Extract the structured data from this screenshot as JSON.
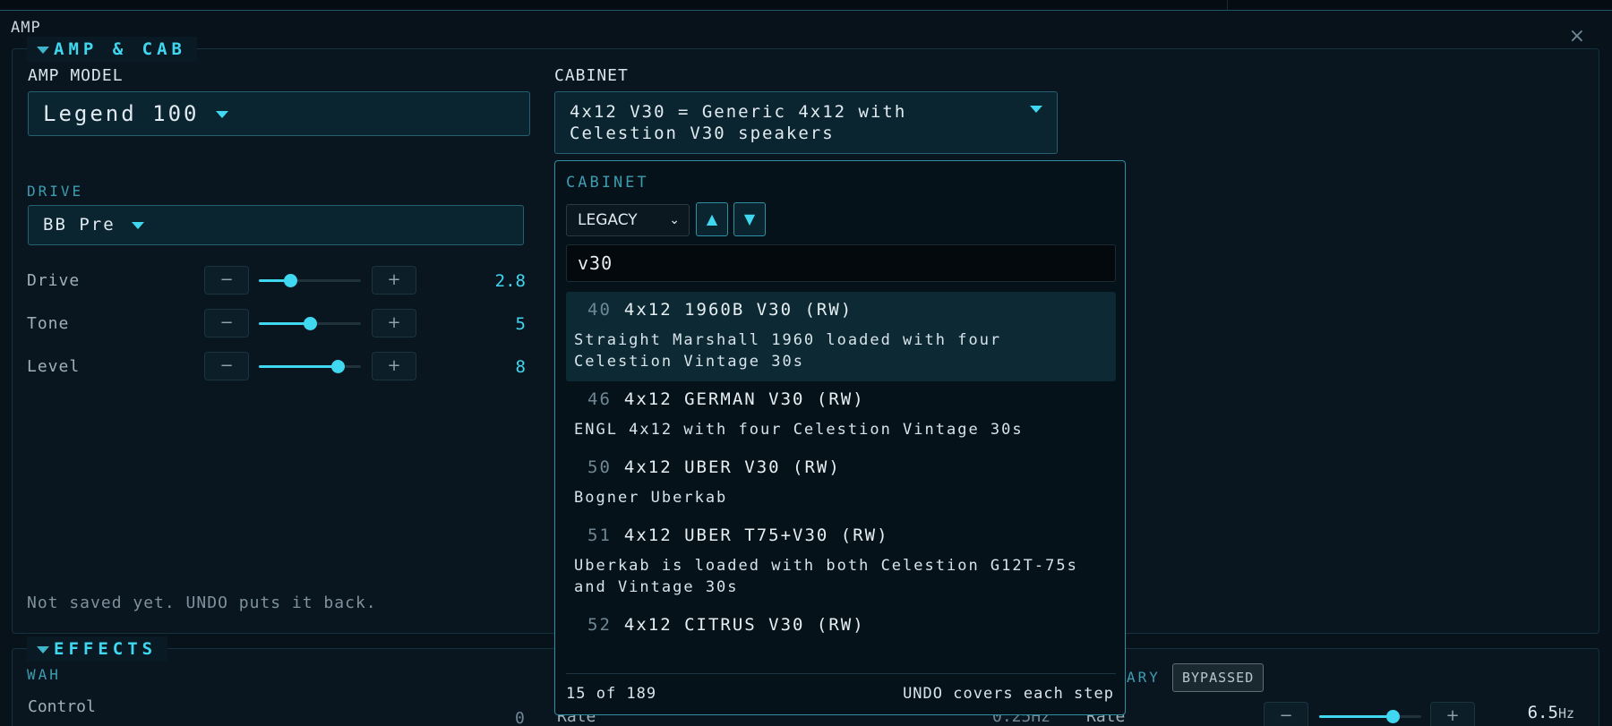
{
  "window": {
    "title": "AMP",
    "close_glyph": "×"
  },
  "amp_section": {
    "tab_label": "AMP & CAB",
    "amp_model_label": "AMP MODEL",
    "amp_model_value": "Legend 100",
    "cabinet_label": "CABINET",
    "cabinet_value": "4x12 V30 = Generic 4x12 with Celestion V30 speakers",
    "cabinet_value_line1": "4x12 V30 = Generic 4x12 with",
    "cabinet_value_line2": "Celestion V30 speakers",
    "drive_label": "DRIVE",
    "drive_value": "BB Pre",
    "params": [
      {
        "name": "Drive",
        "value": "2.8",
        "level": 0.31
      },
      {
        "name": "Tone",
        "value": "5",
        "level": 0.5
      },
      {
        "name": "Level",
        "value": "8",
        "level": 0.77
      }
    ],
    "status": "Not saved yet. UNDO puts it back."
  },
  "effects_section": {
    "tab_label": "EFFECTS",
    "wah_label": "WAH",
    "control_label": "Control",
    "control_value": "0",
    "rate_label_partial": "Rate",
    "rate_value_partial": "0.25Hz",
    "rotary_label_partial": "ARY",
    "bypassed_label": "BYPASSED",
    "rate2_label": "Rate",
    "rate2_value": "6.5",
    "rate2_unit": "Hz"
  },
  "stepper": {
    "minus": "−",
    "plus": "+"
  },
  "cabinet_popup": {
    "title": "CABINET",
    "filter_value": "LEGACY",
    "sort_up": "▲",
    "sort_down": "▼",
    "search_value": "v30",
    "results": [
      {
        "num": "40",
        "name": "4x12 1960B V30 (RW)",
        "desc": "Straight Marshall 1960 loaded with four Celestion Vintage 30s",
        "selected": true
      },
      {
        "num": "46",
        "name": "4x12 GERMAN V30 (RW)",
        "desc": "ENGL 4x12 with four Celestion Vintage 30s",
        "selected": false
      },
      {
        "num": "50",
        "name": "4x12 UBER V30 (RW)",
        "desc": "Bogner Uberkab",
        "selected": false
      },
      {
        "num": "51",
        "name": "4x12 UBER T75+V30 (RW)",
        "desc": "Uberkab is loaded with both Celestion G12T-75s and Vintage 30s",
        "selected": false
      },
      {
        "num": "52",
        "name": "4x12 CITRUS V30 (RW)",
        "desc": "",
        "selected": false
      }
    ],
    "count_text": "15 of 189",
    "undo_note": "UNDO covers each step"
  },
  "colors": {
    "accent": "#3fd8f0",
    "panel_bg": "#091620",
    "page_bg": "#07121a"
  }
}
